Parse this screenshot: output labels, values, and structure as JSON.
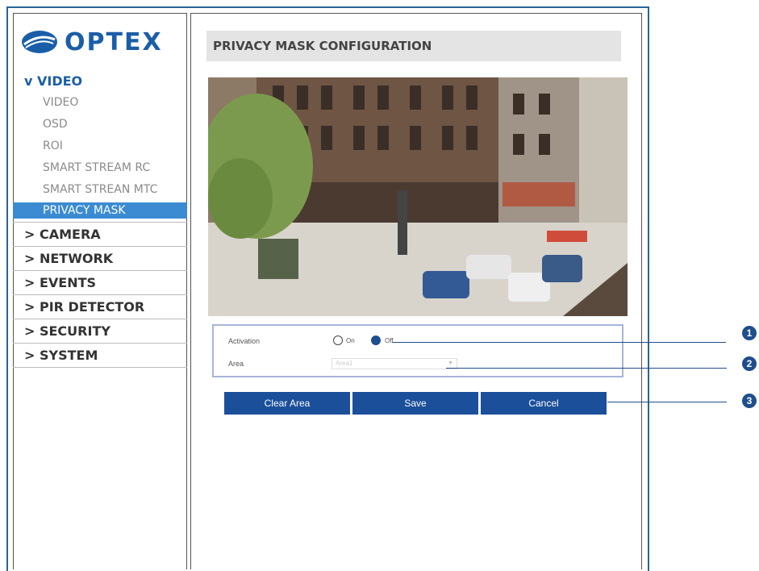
{
  "brand": {
    "logo_text": "OPTEX"
  },
  "nav": {
    "section": {
      "label": "v VIDEO"
    },
    "video_items": [
      {
        "label": "VIDEO"
      },
      {
        "label": "OSD"
      },
      {
        "label": "ROI"
      },
      {
        "label": "SMART STREAM RC"
      },
      {
        "label": "SMART STREAN MTC"
      },
      {
        "label": "PRIVACY MASK"
      }
    ],
    "groups": [
      {
        "label": "> CAMERA"
      },
      {
        "label": "> NETWORK"
      },
      {
        "label": "> EVENTS"
      },
      {
        "label": "> PIR DETECTOR"
      },
      {
        "label": "> SECURITY"
      },
      {
        "label": "> SYSTEM"
      }
    ]
  },
  "page": {
    "title": "PRIVACY MASK CONFIGURATION"
  },
  "form": {
    "activation_label": "Activation",
    "on_label": "On",
    "off_label": "Off",
    "activation_value": "Off",
    "area_label": "Area",
    "area_value": "Area1"
  },
  "buttons": {
    "clear_area": "Clear Area",
    "save": "Save",
    "cancel": "Cancel"
  },
  "callouts": [
    "1",
    "2",
    "3"
  ],
  "colors": {
    "brand_blue": "#1b5ea8",
    "active_bg": "#3a8bd2",
    "button_blue": "#1b4f9a"
  }
}
